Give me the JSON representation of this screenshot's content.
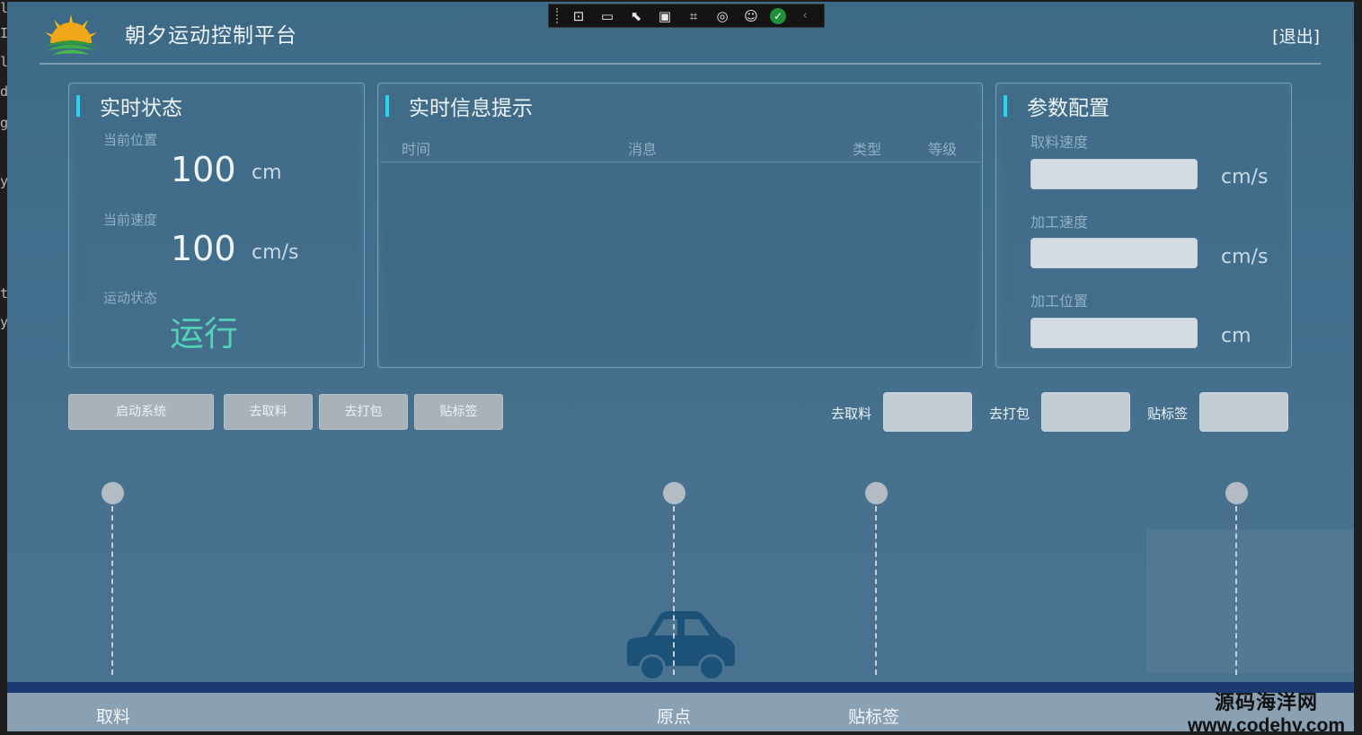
{
  "app": {
    "title": "朝夕运动控制平台",
    "logout_label": "[退出]"
  },
  "colors": {
    "accent_bar": "#27d6f2",
    "running_text": "#52d1b7",
    "rail": "#1c3a72",
    "car": "#1c5278"
  },
  "debug_toolbar": {
    "icons": [
      "select-element-icon",
      "video-icon",
      "pointer-select-icon",
      "layout-adorner-icon",
      "display-layout-icon",
      "hot-reload-icon",
      "accessibility-icon",
      "ok-check-icon",
      "collapse-chevron-icon"
    ]
  },
  "status_panel": {
    "title": "实时状态",
    "position_label": "当前位置",
    "position_value": "100",
    "position_unit": "cm",
    "speed_label": "当前速度",
    "speed_value": "100",
    "speed_unit": "cm/s",
    "state_label": "运动状态",
    "state_value": "运行"
  },
  "info_panel": {
    "title": "实时信息提示",
    "columns": [
      "时间",
      "消息",
      "类型",
      "等级"
    ],
    "rows": []
  },
  "params_panel": {
    "title": "参数配置",
    "fields": [
      {
        "label": "取料速度",
        "value": "",
        "unit": "cm/s"
      },
      {
        "label": "加工速度",
        "value": "",
        "unit": "cm/s"
      },
      {
        "label": "加工位置",
        "value": "",
        "unit": "cm"
      }
    ]
  },
  "controls": {
    "buttons": [
      "启动系统",
      "去取料",
      "去打包",
      "贴标签"
    ],
    "inputs": [
      {
        "label": "去取料",
        "value": ""
      },
      {
        "label": "去打包",
        "value": ""
      },
      {
        "label": "贴标签",
        "value": ""
      }
    ]
  },
  "track": {
    "stations": [
      "取料",
      "原点",
      "贴标签"
    ]
  },
  "watermark": {
    "line1": "源码海洋网",
    "line2": "www.codehy.com"
  }
}
